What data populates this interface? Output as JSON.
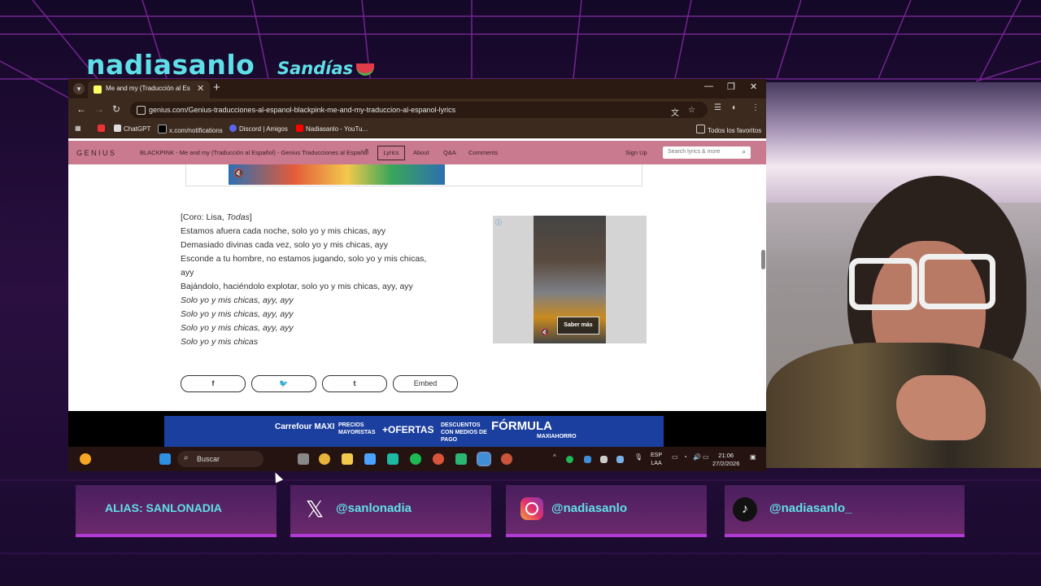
{
  "overlay": {
    "channel_name": "nadiasanlo",
    "sub_title": "Sandías",
    "socials": [
      {
        "label": "ALIAS: SANLONADIA",
        "icon": "none"
      },
      {
        "label": "@sanlonadia",
        "icon": "x-icon"
      },
      {
        "label": "@nadiasanlo",
        "icon": "instagram-icon"
      },
      {
        "label": "@nadiasanlo_",
        "icon": "tiktok-icon"
      }
    ]
  },
  "browser": {
    "tab_title": "Me and my (Traducción al Espa",
    "url": "genius.com/Genius-traducciones-al-espanol-blackpink-me-and-my-traduccion-al-espanol-lyrics",
    "bookmarks": [
      "ChatGPT",
      "x.com/notifications",
      "Discord | Amigos",
      "Nadiasanlo - YouTu...",
      "Todos los favoritos"
    ]
  },
  "genius": {
    "logo": "GENIUS",
    "song_title": "BLACKPINK - Me and my (Traducción al Español) - Genius Traducciones al Español",
    "nav": [
      "Lyrics",
      "About",
      "Q&A",
      "Comments"
    ],
    "sign_up": "Sign Up",
    "search_placeholder": "Search lyrics & more",
    "lyrics": [
      {
        "text": "[Coro: Lisa, ",
        "italic_suffix": "Todas",
        "closing": "]"
      },
      {
        "text": "Estamos afuera cada noche, solo yo y mis chicas, ayy"
      },
      {
        "text": "Demasiado divinas cada vez, solo yo y mis chicas, ayy"
      },
      {
        "text": "Esconde a tu hombre, no estamos jugando, solo yo y mis chicas,"
      },
      {
        "text": "ayy"
      },
      {
        "text": "Bajándolo, haciéndolo explotar, solo yo y mis chicas, ayy, ayy"
      },
      {
        "text": "Solo yo y mis chicas, ayy, ayy",
        "italic": true
      },
      {
        "text": "Solo yo y mis chicas, ayy, ayy",
        "italic": true
      },
      {
        "text": "Solo yo y mis chicas, ayy, ayy",
        "italic": true
      },
      {
        "text": "Solo yo y mis chicas",
        "italic": true
      }
    ],
    "side_ad_cta": "Saber más",
    "share": [
      "f",
      "🐦",
      "t",
      "Embed"
    ]
  },
  "banner_ad": {
    "brand": "Carrefour MAXI",
    "text1": "PRECIOS MAYORISTAS",
    "text2": "+OFERTAS",
    "text3": "DESCUENTOS CON MEDIOS DE PAGO",
    "text4": "FÓRMULA",
    "text5": "MAXIAHORRO"
  },
  "taskbar": {
    "search": "Buscar",
    "lang1": "ESP",
    "lang2": "LAA",
    "time": "21:06",
    "date": "27/2/2026"
  }
}
